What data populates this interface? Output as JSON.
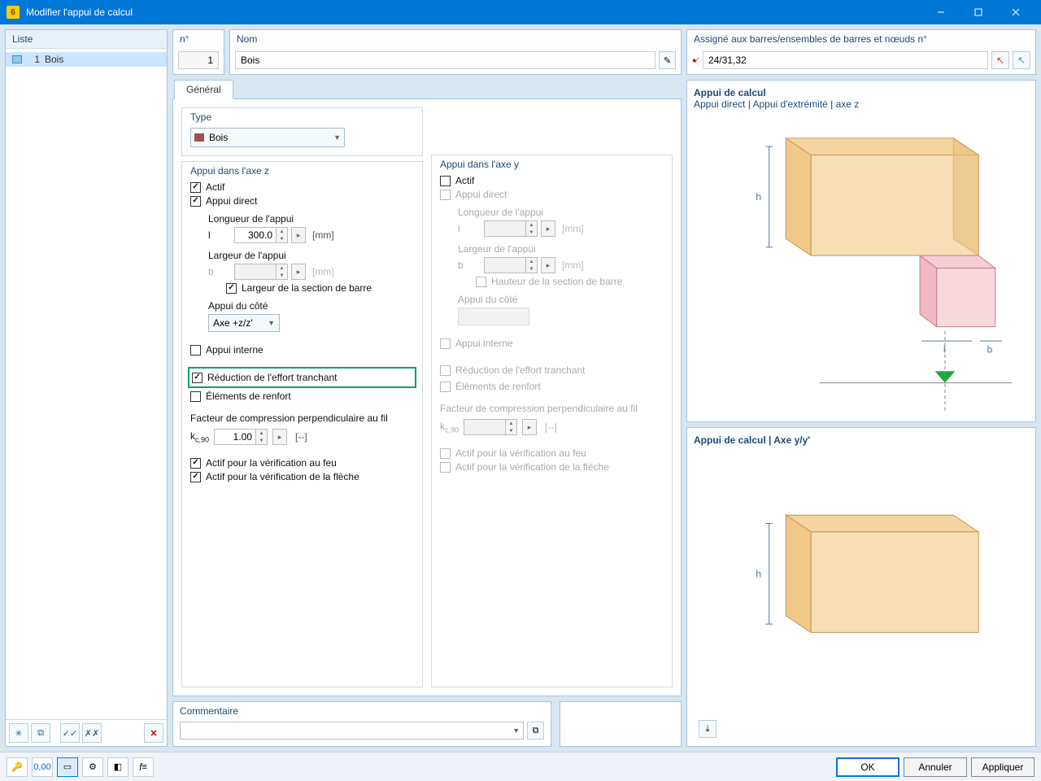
{
  "window": {
    "title": "Modifier l'appui de calcul"
  },
  "liste": {
    "header": "Liste",
    "items": [
      {
        "num": "1",
        "name": "Bois"
      }
    ]
  },
  "fields": {
    "num_label": "n°",
    "num_value": "1",
    "name_label": "Nom",
    "name_value": "Bois",
    "assigned_label": "Assigné aux barres/ensembles de barres et nœuds n°",
    "assigned_value": "24/31,32"
  },
  "tab": {
    "general": "Général"
  },
  "type": {
    "label": "Type",
    "value": "Bois"
  },
  "axis_z": {
    "title": "Appui dans l'axe z",
    "active": "Actif",
    "direct": "Appui direct",
    "length_label": "Longueur de l'appui",
    "l_var": "l",
    "l_value": "300.0",
    "l_unit": "[mm]",
    "width_label": "Largeur de l'appui",
    "b_var": "b",
    "b_unit": "[mm]",
    "width_section": "Largeur de la section de barre",
    "side_label": "Appui du côté",
    "side_value": "Axe +z/z'",
    "internal": "Appui interne",
    "shear_reduction": "Réduction de l'effort tranchant",
    "reinforcement": "Éléments de renfort",
    "kc_label": "Facteur de compression perpendiculaire au fil",
    "kc_var": "k",
    "kc_sub": "c,90",
    "kc_value": "1.00",
    "kc_unit": "[--]",
    "fire": "Actif pour la vérification au feu",
    "deflection": "Actif pour la vérification de la flèche"
  },
  "axis_y": {
    "title": "Appui dans l'axe y",
    "active": "Actif",
    "direct": "Appui direct",
    "length_label": "Longueur de l'appui",
    "l_var": "l",
    "l_unit": "[mm]",
    "width_label": "Largeur de l'appui",
    "b_var": "b",
    "b_unit": "[mm]",
    "height_section": "Hauteur de la section de barre",
    "side_label": "Appui du côté",
    "internal": "Appui interne",
    "shear_reduction": "Réduction de l'effort tranchant",
    "reinforcement": "Éléments de renfort",
    "kc_label": "Facteur de compression perpendiculaire au fil",
    "kc_var": "k",
    "kc_sub": "c,90",
    "kc_unit": "[--]",
    "fire": "Actif pour la vérification au feu",
    "deflection": "Actif pour la vérification de la flèche"
  },
  "comment": {
    "label": "Commentaire"
  },
  "preview1": {
    "title": "Appui de calcul",
    "sub": "Appui direct | Appui d'extrémité | axe z",
    "h": "h",
    "l": "l",
    "b": "b"
  },
  "preview2": {
    "title": "Appui de calcul | Axe y/y'",
    "h": "h"
  },
  "footer": {
    "ok": "OK",
    "cancel": "Annuler",
    "apply": "Appliquer"
  }
}
